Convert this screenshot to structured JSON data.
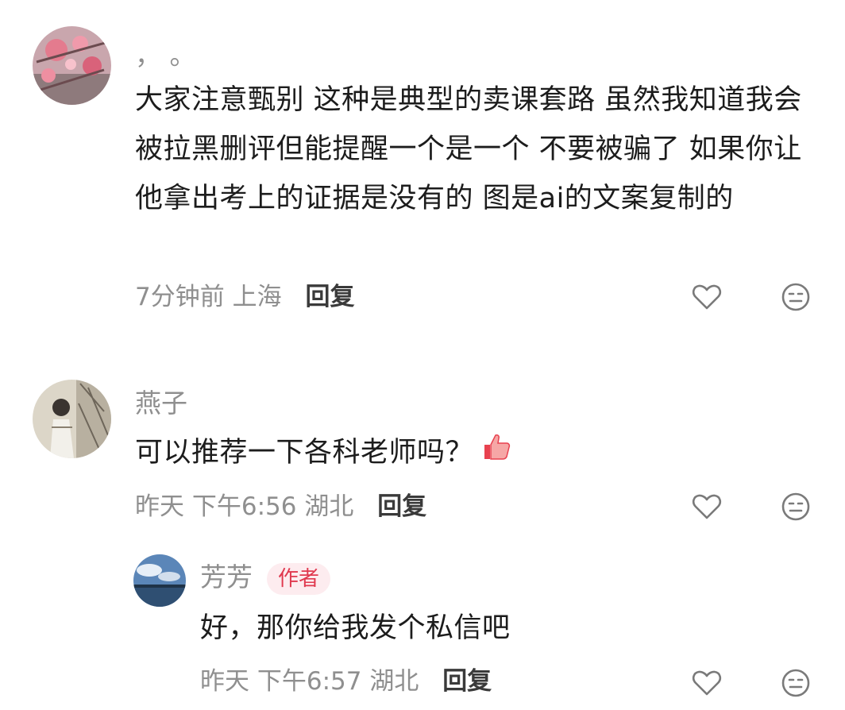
{
  "comments": [
    {
      "username": "， 。",
      "text": "大家注意甄别 这种是典型的卖课套路 虽然我知道我会被拉黑删评但能提醒一个是一个 不要被骗了 如果你让他拿出考上的证据是没有的 图是ai的文案复制的",
      "time": "7分钟前",
      "location": "上海",
      "reply_label": "回复"
    },
    {
      "username": "燕子",
      "text": "可以推荐一下各科老师吗？",
      "emoji": "thumbs-up-emoji",
      "time": "昨天 下午6:56",
      "location": "湖北",
      "reply_label": "回复",
      "replies": [
        {
          "username": "芳芳",
          "badge": "作者",
          "text": "好，那你给我发个私信吧",
          "time": "昨天 下午6:57",
          "location": "湖北",
          "reply_label": "回复"
        }
      ]
    }
  ],
  "icons": {
    "like": "heart-icon",
    "dislike": "meh-face-icon"
  },
  "colors": {
    "username": "#8f8f8f",
    "text": "#1c1c1c",
    "badge_text": "#e0394f",
    "badge_bg": "#fdecef"
  }
}
